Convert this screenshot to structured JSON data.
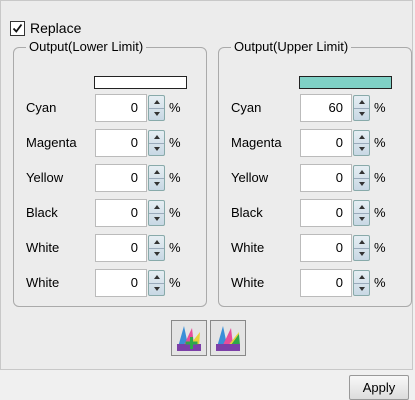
{
  "replace": {
    "label": "Replace",
    "checked": true
  },
  "lower": {
    "title": "Output(Lower Limit)",
    "swatch_color": "#ffffff",
    "rows": [
      {
        "label": "Cyan",
        "value": "0",
        "unit": "%"
      },
      {
        "label": "Magenta",
        "value": "0",
        "unit": "%"
      },
      {
        "label": "Yellow",
        "value": "0",
        "unit": "%"
      },
      {
        "label": "Black",
        "value": "0",
        "unit": "%"
      },
      {
        "label": "White",
        "value": "0",
        "unit": "%"
      },
      {
        "label": "White",
        "value": "0",
        "unit": "%"
      }
    ]
  },
  "upper": {
    "title": "Output(Upper Limit)",
    "swatch_color": "#7fd1c6",
    "rows": [
      {
        "label": "Cyan",
        "value": "60",
        "unit": "%"
      },
      {
        "label": "Magenta",
        "value": "0",
        "unit": "%"
      },
      {
        "label": "Yellow",
        "value": "0",
        "unit": "%"
      },
      {
        "label": "Black",
        "value": "0",
        "unit": "%"
      },
      {
        "label": "White",
        "value": "0",
        "unit": "%"
      },
      {
        "label": "White",
        "value": "0",
        "unit": "%"
      }
    ]
  },
  "icons": [
    "color-swatch-add-icon",
    "color-swatch-icon"
  ],
  "apply_label": "Apply"
}
